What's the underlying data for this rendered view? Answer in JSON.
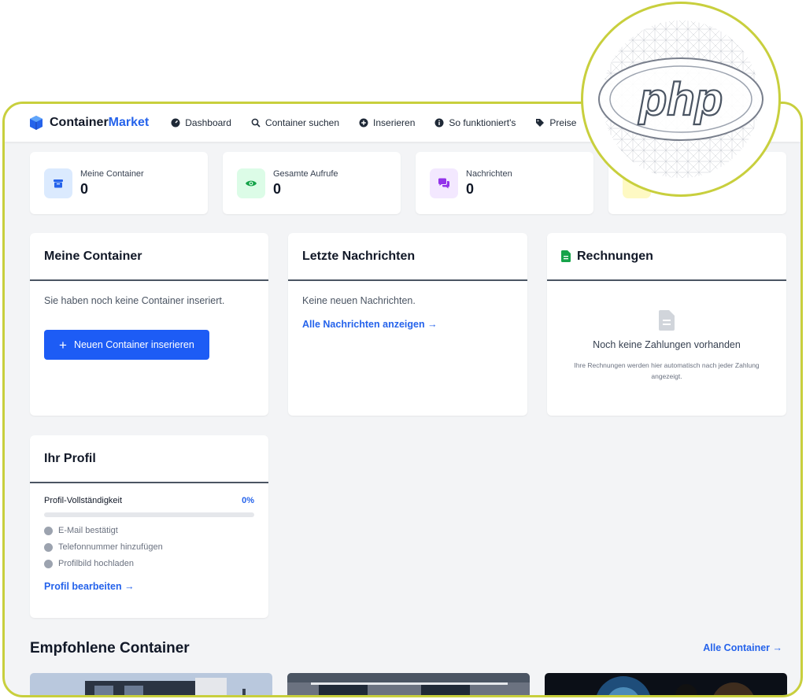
{
  "brand": {
    "name_part1": "Container",
    "name_part2": "Market"
  },
  "nav": [
    {
      "label": "Dashboard",
      "icon": "dashboard-icon"
    },
    {
      "label": "Container suchen",
      "icon": "search-icon"
    },
    {
      "label": "Inserieren",
      "icon": "plus-circle-icon"
    },
    {
      "label": "So funktioniert's",
      "icon": "info-icon"
    },
    {
      "label": "Preise",
      "icon": "tags-icon"
    }
  ],
  "stats": [
    {
      "label": "Meine Container",
      "value": "0",
      "icon": "box-icon",
      "color": "#dbeafe",
      "icon_color": "#2563eb"
    },
    {
      "label": "Gesamte Aufrufe",
      "value": "0",
      "icon": "eye-icon",
      "color": "#dcfce7",
      "icon_color": "#16a34a"
    },
    {
      "label": "Nachrichten",
      "value": "0",
      "icon": "chat-icon",
      "color": "#f3e8ff",
      "icon_color": "#9333ea"
    },
    {
      "label": "",
      "value": "",
      "icon": "",
      "color": "#fef9c3",
      "icon_color": "#ca8a04"
    }
  ],
  "my_containers": {
    "title": "Meine Container",
    "empty_text": "Sie haben noch keine Container inseriert.",
    "button_label": "Neuen Container inserieren"
  },
  "messages": {
    "title": "Letzte Nachrichten",
    "empty_text": "Keine neuen Nachrichten.",
    "link_label": "Alle Nachrichten anzeigen →"
  },
  "invoices": {
    "title": "Rechnungen",
    "empty_title": "Noch keine Zahlungen vorhanden",
    "empty_desc": "Ihre Rechnungen werden hier automatisch nach jeder Zahlung angezeigt."
  },
  "profile": {
    "title": "Ihr Profil",
    "completeness_label": "Profil-Vollständigkeit",
    "completeness_value": "0%",
    "completeness_fraction": 0,
    "checklist": [
      "E-Mail bestätigt",
      "Telefonnummer hinzufügen",
      "Profilbild hochladen"
    ],
    "edit_link": "Profil bearbeiten →"
  },
  "featured": {
    "title": "Empfohlene Container",
    "all_link": "Alle Container →"
  },
  "badge": {
    "text": "php"
  }
}
